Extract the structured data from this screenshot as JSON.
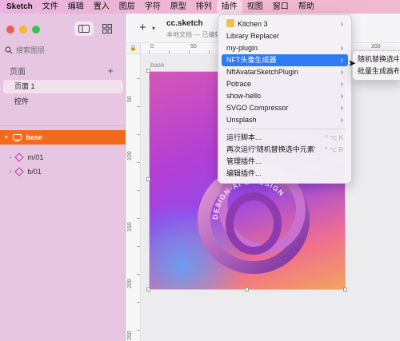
{
  "menubar": {
    "items": [
      "Sketch",
      "文件",
      "编辑",
      "置入",
      "图层",
      "字符",
      "原型",
      "排列",
      "插件",
      "视图",
      "窗口",
      "帮助"
    ],
    "active_index": 8
  },
  "sidebar": {
    "search_placeholder": "搜索图层",
    "pages_label": "页面",
    "add_page_symbol": "+",
    "pages": [
      "页面 1",
      "控件"
    ],
    "layers": [
      {
        "label": "base",
        "selected": true
      },
      {
        "label": "m/01"
      },
      {
        "label": "b/01"
      }
    ]
  },
  "toolbar": {
    "insert_symbol": "+",
    "doc_title": "cc.sketch",
    "doc_subtitle": "本地文档 — 已编辑"
  },
  "rulers": {
    "top_labels": [
      "0",
      "50",
      "200"
    ],
    "left_labels": [
      "50",
      "100",
      "150",
      "200",
      "250"
    ]
  },
  "artboard": {
    "label": "base",
    "ring_text": "DESIGN-AI-L DESIGN"
  },
  "plugins_menu": {
    "items": [
      {
        "label": "Kitchen 3",
        "submenu": true,
        "icon": "kitchen-icon"
      },
      {
        "label": "Library Replacer"
      },
      {
        "label": "my-plugin",
        "submenu": true
      },
      {
        "label": "NFT头像生成器",
        "submenu": true,
        "highlighted": true
      },
      {
        "label": "NftAvatarSketchPlugin",
        "submenu": true
      },
      {
        "label": "Potrace",
        "submenu": true
      },
      {
        "label": "show-hello",
        "submenu": true
      },
      {
        "label": "SVGO Compressor",
        "submenu": true
      },
      {
        "label": "Unsplash",
        "submenu": true
      }
    ],
    "footer_items": [
      {
        "label": "运行脚本...",
        "shortcut": "^ ⌥ K"
      },
      {
        "label": "再次运行'随机替换选中元素'",
        "shortcut": "^ ⌥ R"
      },
      {
        "label": "管理插件..."
      },
      {
        "label": "编辑插件..."
      }
    ]
  },
  "submenu": {
    "items": [
      "随机替换选中",
      "批量生成画布"
    ]
  },
  "colors": {
    "accent": "#2f7bf5",
    "layer_selected": "#f36a1c",
    "layer_icon": "#b43aa6"
  }
}
